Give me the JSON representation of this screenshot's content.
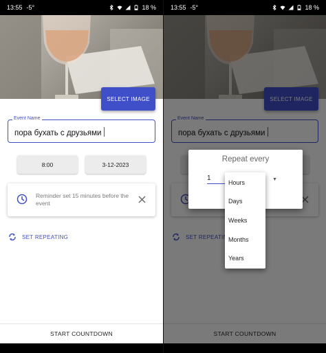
{
  "status": {
    "time": "13:55",
    "temperature": "-5°",
    "battery": "18 %"
  },
  "screen": {
    "select_image_label": "SELECT IMAGE",
    "event_name": {
      "label": "Event Name",
      "value": "пора бухать с друзьями"
    },
    "time_button": "8:00",
    "date_button": "3-12-2023",
    "reminder_text": "Reminder set 15 minutes before the event",
    "set_repeating_label": "SET REPEATING",
    "start_countdown_label": "START COUNTDOWN"
  },
  "dialog": {
    "title": "Repeat every",
    "number": "1",
    "options": [
      "Hours",
      "Days",
      "Weeks",
      "Months",
      "Years"
    ]
  },
  "colors": {
    "accent": "#3f4ec9",
    "scrim": "rgba(0,0,0,0.52)"
  },
  "icons": [
    "bluetooth-icon",
    "wifi-icon",
    "signal-icon",
    "battery-icon",
    "clock-icon",
    "close-icon",
    "repeat-icon",
    "dropdown-arrow-icon"
  ]
}
